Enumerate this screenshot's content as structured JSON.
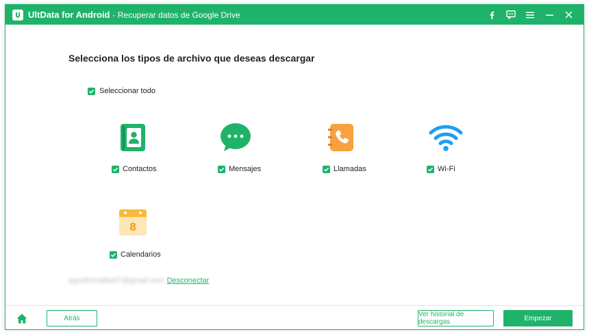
{
  "titlebar": {
    "app_name": "UltData for Android",
    "subtitle": "- Recuperar datos de Google Drive",
    "icons": [
      "facebook-icon",
      "feedback-icon",
      "menu-icon",
      "minimize-icon",
      "close-icon"
    ]
  },
  "main": {
    "heading": "Selecciona los tipos de archivo que deseas descargar",
    "select_all_label": "Seleccionar todo",
    "categories": [
      {
        "label": "Contactos",
        "icon": "contacts-icon",
        "checked": true
      },
      {
        "label": "Mensajes",
        "icon": "messages-icon",
        "checked": true
      },
      {
        "label": "Llamadas",
        "icon": "calls-icon",
        "checked": true
      },
      {
        "label": "Wi-Fi",
        "icon": "wifi-icon",
        "checked": true
      },
      {
        "label": "Calendarios",
        "icon": "calendar-icon",
        "checked": true,
        "calendar_day": "8"
      }
    ]
  },
  "account": {
    "email": "agustinmalbert7@gmail.com",
    "disconnect_label": "Desconectar"
  },
  "footer": {
    "back_label": "Atrás",
    "history_label": "Ver historial de descargas",
    "start_label": "Empezar"
  },
  "colors": {
    "accent": "#1fb36a",
    "calls_orange": "#f7a13f",
    "wifi_blue": "#1e9ff2",
    "calendar_yellow": "#f9c548"
  }
}
